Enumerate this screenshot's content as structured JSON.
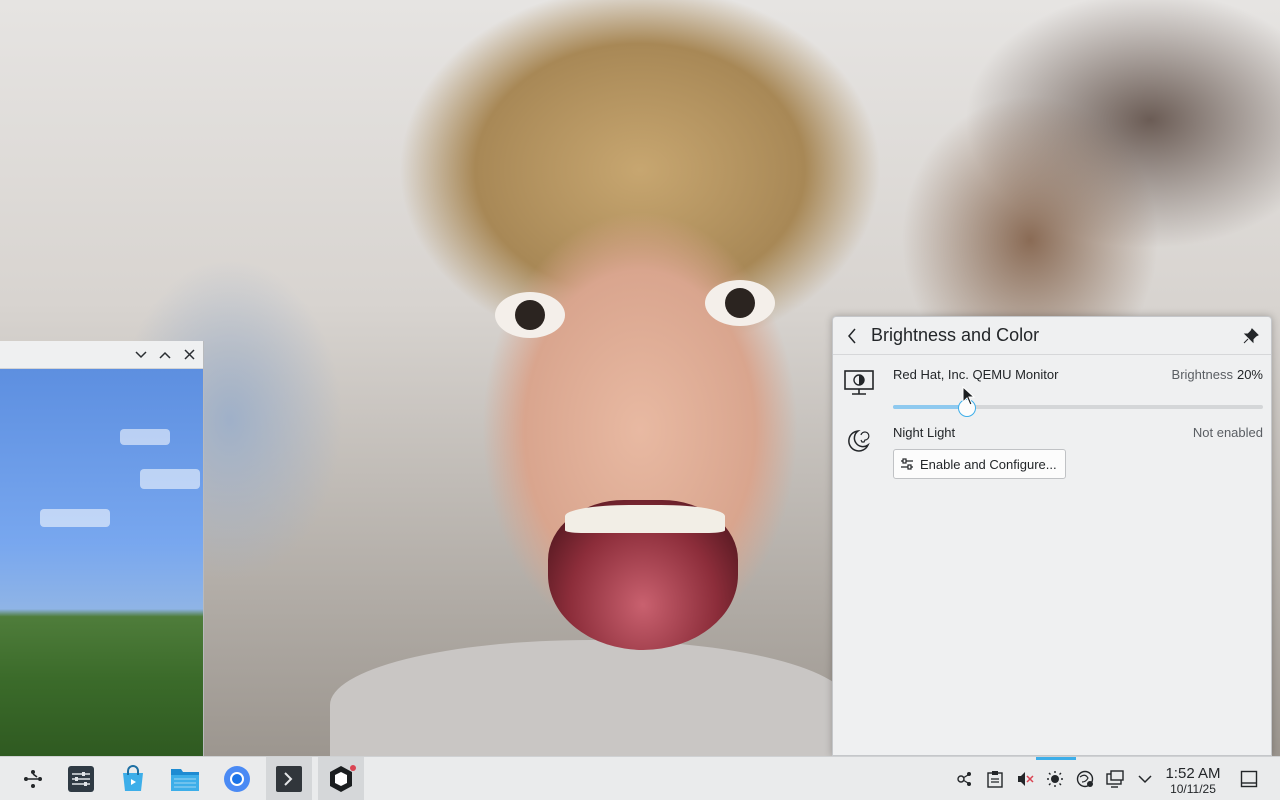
{
  "panel": {
    "title": "Brightness and Color",
    "monitor": {
      "name": "Red Hat, Inc. QEMU Monitor",
      "brightness_label": "Brightness",
      "brightness_value": "20%",
      "brightness_fraction": 0.2
    },
    "night_light": {
      "label": "Night Light",
      "status": "Not enabled",
      "button_label": "Enable and Configure..."
    }
  },
  "taskbar": {
    "apps": [
      "app-launcher-icon",
      "system-settings-icon",
      "discover-store-icon",
      "file-manager-icon",
      "chromium-browser-icon",
      "terminal-icon",
      "minecraft-icon"
    ],
    "tray": [
      "kde-connect-icon",
      "clipboard-icon",
      "volume-muted-icon",
      "brightness-icon",
      "network-icon",
      "display-icon",
      "expand-tray-icon"
    ],
    "clock": {
      "time": "1:52 AM",
      "date": "10/11/25"
    }
  },
  "colors": {
    "accent": "#3daee9",
    "panel_bg": "#eff0f1",
    "taskbar_bg": "#eaebec"
  }
}
